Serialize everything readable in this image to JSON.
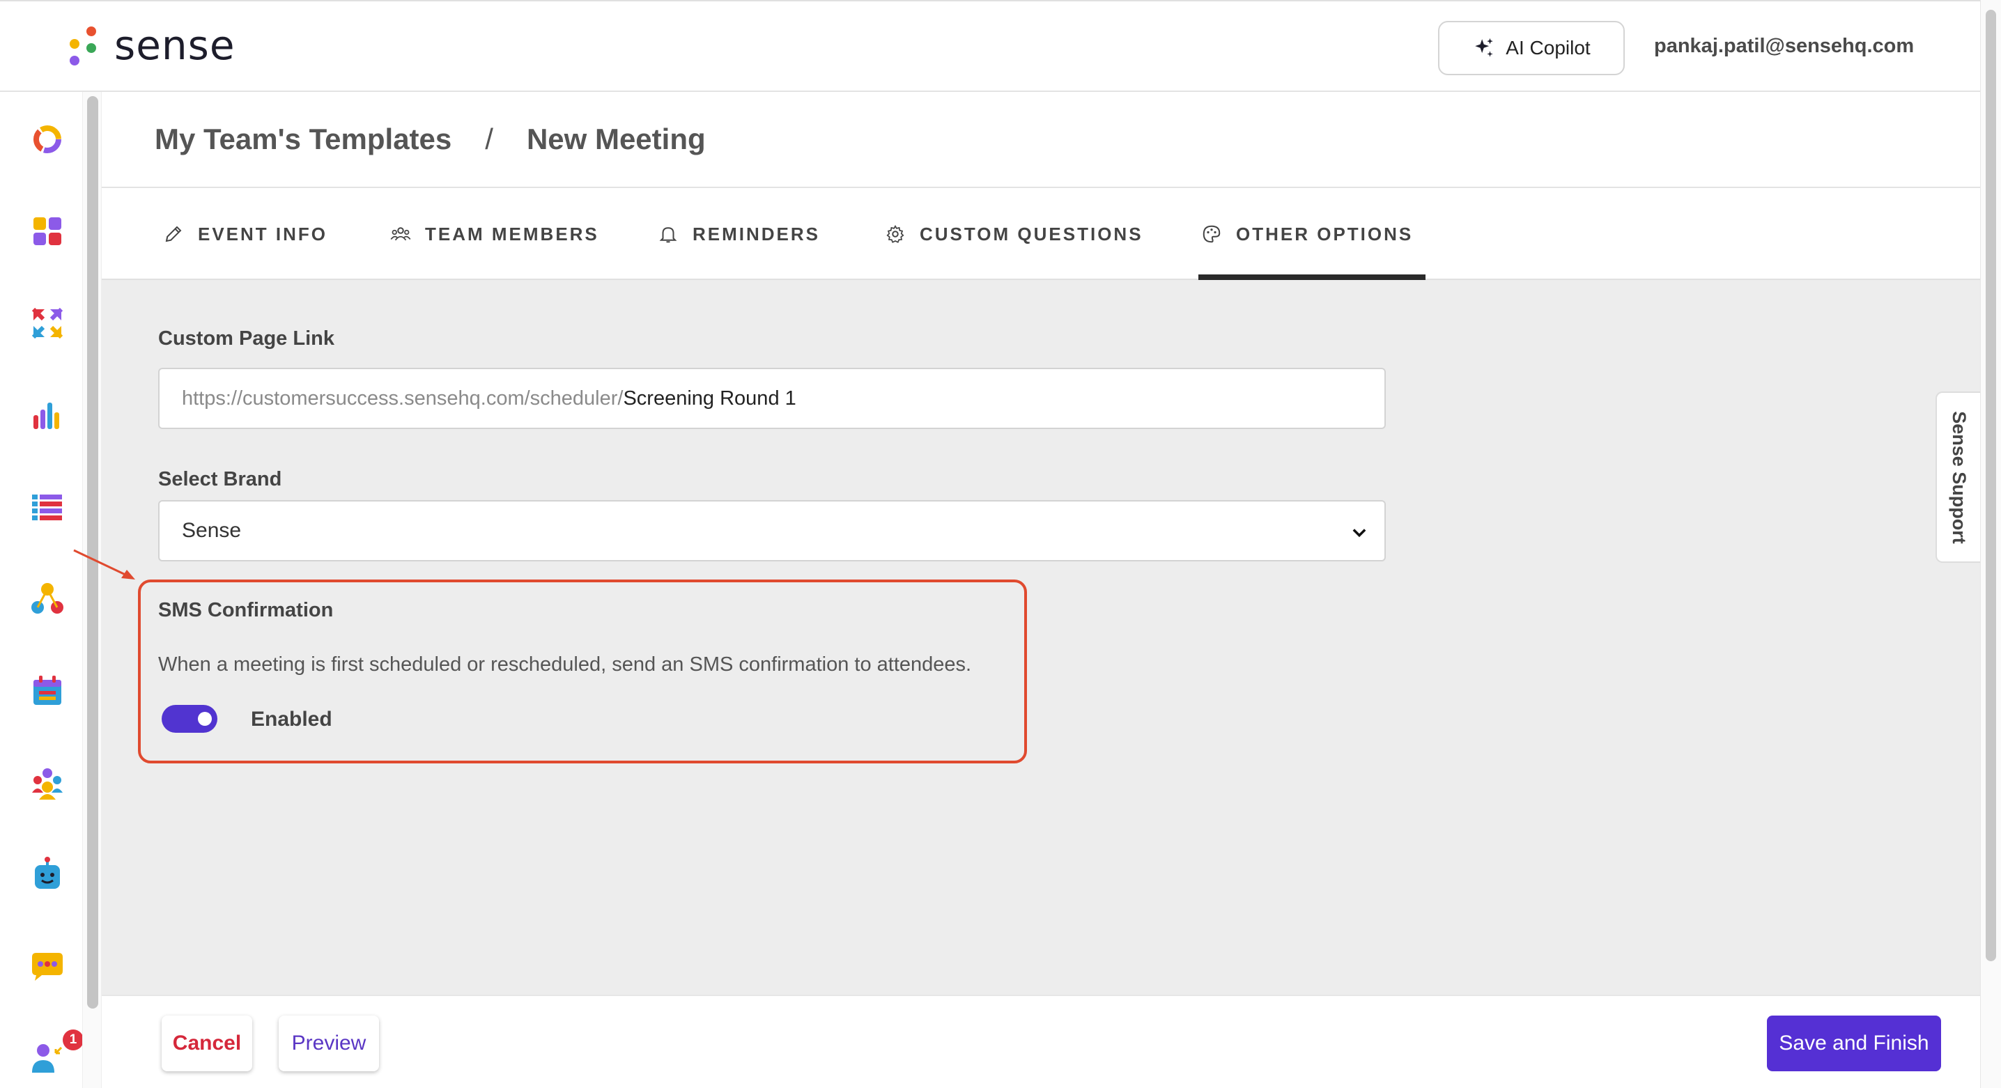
{
  "app": {
    "name": "sense",
    "brand_dot_colors": [
      "#e8512f",
      "#f4b400",
      "#3aa757",
      "#8c5ae8"
    ],
    "accent": "#5530d4"
  },
  "header": {
    "copilot_label": "AI Copilot",
    "user_email": "pankaj.patil@sensehq.com"
  },
  "sidebar": {
    "icons": [
      "donut-chart-icon",
      "apps-grid-icon",
      "arrows-swap-icon",
      "bar-chart-icon",
      "list-icon",
      "nodes-icon",
      "calendar-icon",
      "team-icon",
      "bot-icon",
      "chat-icon",
      "user-add-icon"
    ],
    "chat_badge": "1"
  },
  "breadcrumb": {
    "parent": "My Team's Templates",
    "separator": "/",
    "current": "New Meeting"
  },
  "tabs": [
    {
      "label": "EVENT INFO",
      "icon": "pencil-icon"
    },
    {
      "label": "TEAM MEMBERS",
      "icon": "people-icon"
    },
    {
      "label": "REMINDERS",
      "icon": "bell-icon"
    },
    {
      "label": "CUSTOM QUESTIONS",
      "icon": "gear-icon"
    },
    {
      "label": "OTHER OPTIONS",
      "icon": "palette-icon",
      "active": true
    }
  ],
  "form": {
    "custom_link_label": "Custom Page Link",
    "custom_link_prefix": "https://customersuccess.sensehq.com/scheduler/",
    "custom_link_value": "Screening Round 1",
    "brand_label": "Select Brand",
    "brand_value": "Sense",
    "sms": {
      "title": "SMS Confirmation",
      "description": "When a meeting is first scheduled or rescheduled, send an SMS confirmation to attendees.",
      "toggle_label": "Enabled",
      "enabled": true,
      "highlight_color": "#e04a2f"
    }
  },
  "support_tab_label": "Sense Support",
  "footer": {
    "cancel_label": "Cancel",
    "preview_label": "Preview",
    "save_label": "Save and Finish"
  }
}
